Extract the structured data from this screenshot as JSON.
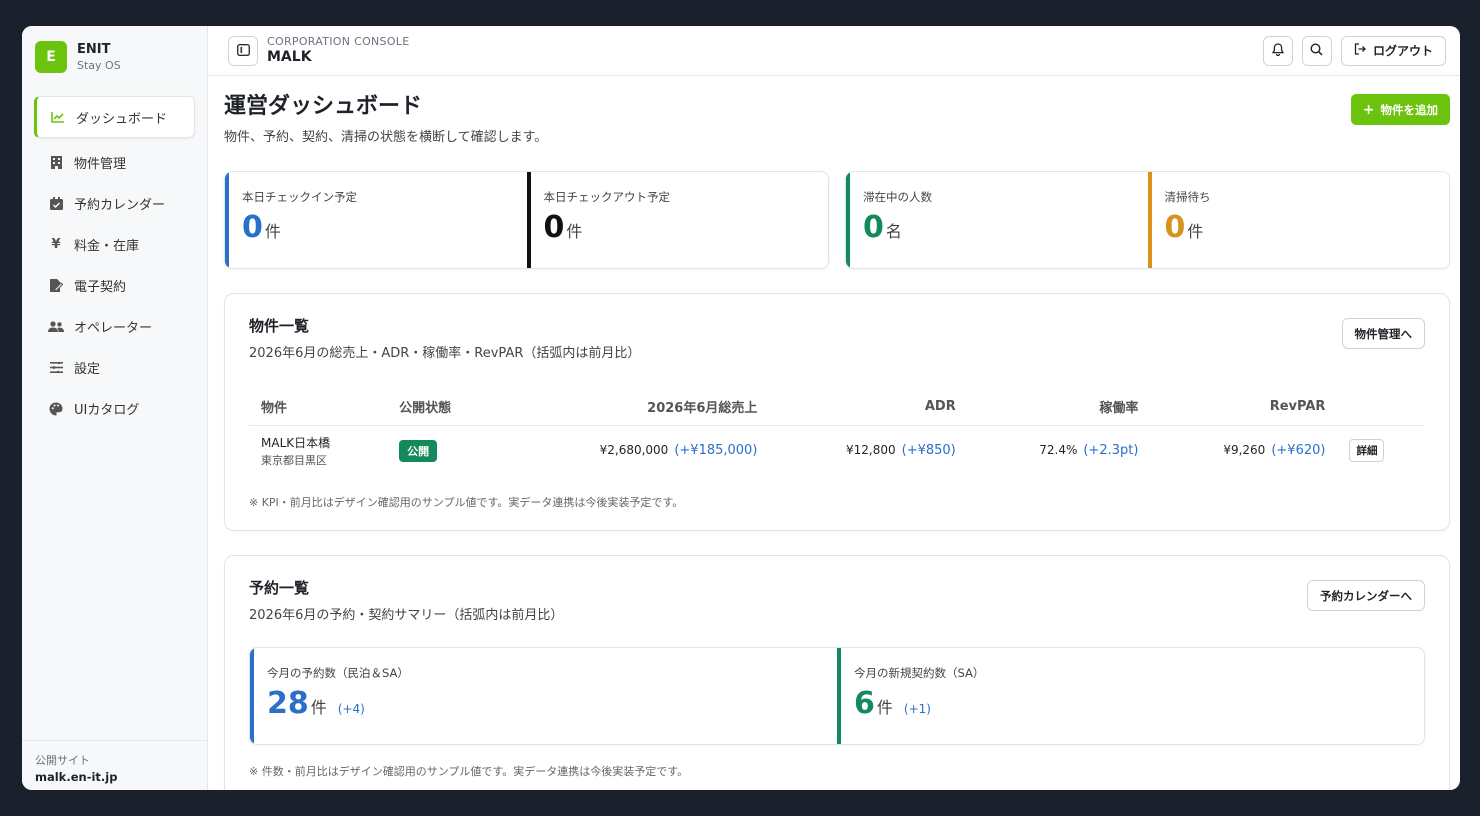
{
  "brand": {
    "logo": "E",
    "name": "ENIT",
    "sub": "Stay OS"
  },
  "sidebar": {
    "items": [
      {
        "label": "ダッシュボード",
        "icon": "chart-icon"
      },
      {
        "label": "物件管理",
        "icon": "building-icon"
      },
      {
        "label": "予約カレンダー",
        "icon": "calendar-icon"
      },
      {
        "label": "料金・在庫",
        "icon": "yen-icon"
      },
      {
        "label": "電子契約",
        "icon": "contract-icon"
      },
      {
        "label": "オペレーター",
        "icon": "users-icon"
      },
      {
        "label": "設定",
        "icon": "sliders-icon"
      },
      {
        "label": "UIカタログ",
        "icon": "palette-icon"
      }
    ],
    "footer_label": "公開サイト",
    "footer_url": "malk.en-it.jp"
  },
  "topbar": {
    "console_label": "CORPORATION CONSOLE",
    "title": "MALK",
    "logout_label": "ログアウト"
  },
  "page": {
    "title": "運営ダッシュボード",
    "subtitle": "物件、予約、契約、清掃の状態を横断して確認します。",
    "add_label": "物件を追加"
  },
  "kpis": [
    {
      "label": "本日チェックイン予定",
      "value": "0",
      "unit": "件",
      "color": "#2a6fc9"
    },
    {
      "label": "本日チェックアウト予定",
      "value": "0",
      "unit": "件",
      "color": "#111111"
    },
    {
      "label": "滞在中の人数",
      "value": "0",
      "unit": "名",
      "color": "#128a5c"
    },
    {
      "label": "清掃待ち",
      "value": "0",
      "unit": "件",
      "color": "#d8921e"
    }
  ],
  "properties": {
    "title": "物件一覧",
    "subtitle": "2026年6月の総売上・ADR・稼働率・RevPAR（括弧内は前月比）",
    "button": "物件管理へ",
    "headers": [
      "物件",
      "公開状態",
      "2026年6月総売上",
      "ADR",
      "稼働率",
      "RevPAR"
    ],
    "rows": [
      {
        "name": "MALK日本橋",
        "area": "東京都目黒区",
        "status": "公開",
        "sales": "¥2,680,000",
        "sales_delta": "(+¥185,000)",
        "adr": "¥12,800",
        "adr_delta": "(+¥850)",
        "occ": "72.4%",
        "occ_delta": "(+2.3pt)",
        "revpar": "¥9,260",
        "revpar_delta": "(+¥620)",
        "detail": "詳細"
      }
    ],
    "note": "※ KPI・前月比はデザイン確認用のサンプル値です。実データ連携は今後実装予定です。"
  },
  "reservations": {
    "title": "予約一覧",
    "subtitle": "2026年6月の予約・契約サマリー（括弧内は前月比）",
    "button": "予約カレンダーへ",
    "kpis": [
      {
        "label": "今月の予約数（民泊＆SA）",
        "value": "28",
        "unit": "件",
        "delta": "(+4)",
        "color": "#2a6fc9"
      },
      {
        "label": "今月の新規契約数（SA）",
        "value": "6",
        "unit": "件",
        "delta": "(+1)",
        "color": "#128a5c"
      }
    ],
    "note": "※ 件数・前月比はデザイン確認用のサンプル値です。実データ連携は今後実装予定です。"
  }
}
